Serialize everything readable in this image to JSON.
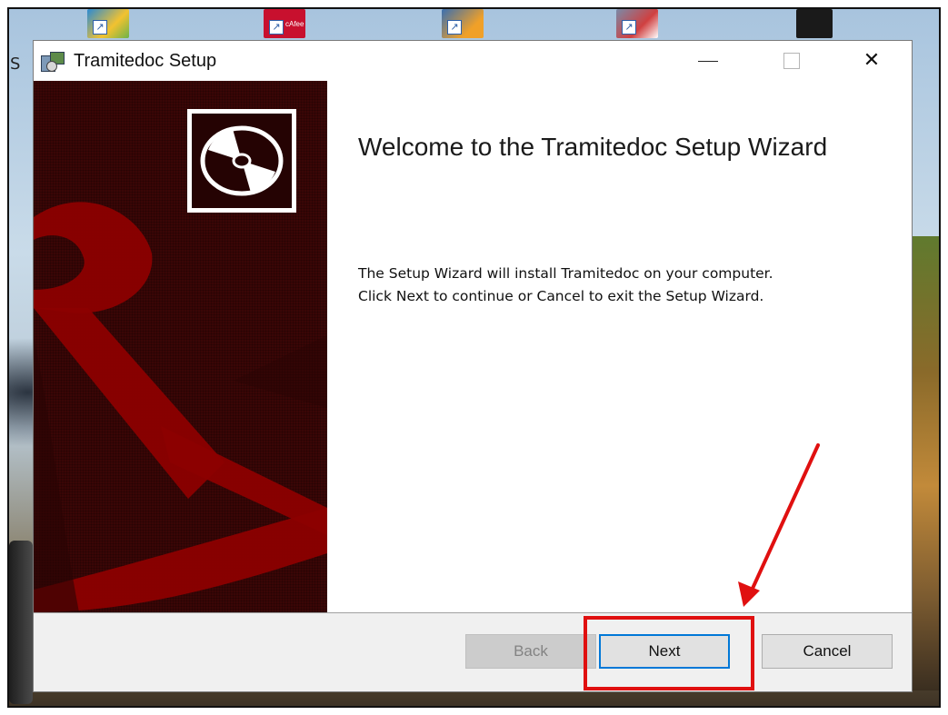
{
  "window": {
    "title": "Tramitedoc Setup",
    "icon": "installer-package-icon",
    "controls": {
      "minimize": "minimize-icon",
      "maximize": "maximize-icon",
      "close_glyph": "✕"
    }
  },
  "desktop": {
    "icons": [
      "shortcut-icon",
      "mcafee-shortcut-icon",
      "shortcut-icon",
      "shortcut-icon"
    ],
    "mcafee_label": "cAfee",
    "left_edge_text": "S"
  },
  "wizard": {
    "banner_icon": "disc-icon",
    "heading": "Welcome to the Tramitedoc Setup Wizard",
    "description_lines": [
      "The Setup Wizard will install Tramitedoc on your computer.",
      "Click Next to continue or Cancel to exit the Setup Wizard."
    ]
  },
  "buttons": {
    "back": "Back",
    "next": "Next",
    "cancel": "Cancel"
  },
  "annotation": {
    "color": "#e01010",
    "target": "next-button"
  },
  "colors": {
    "banner_dark": "#3a0606",
    "banner_red": "#8c0000",
    "focus_blue": "#0078d7"
  }
}
